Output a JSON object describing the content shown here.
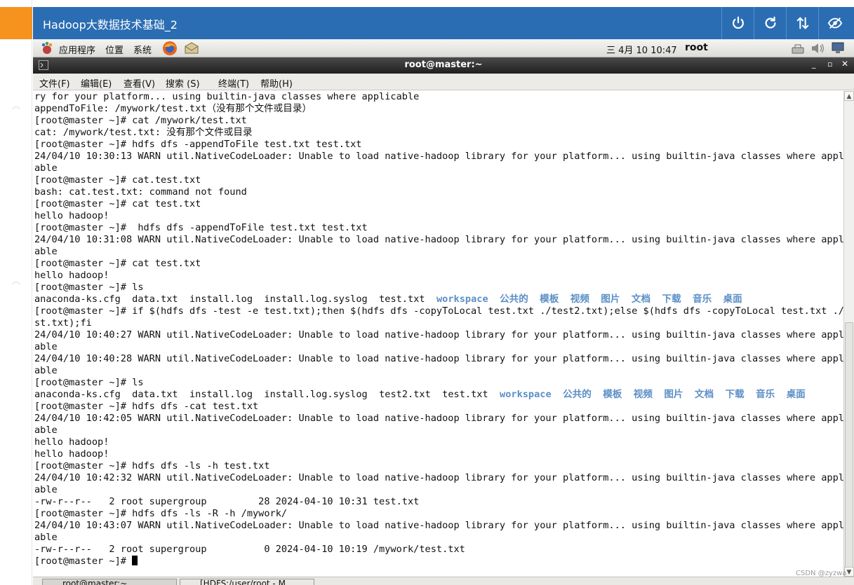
{
  "vm": {
    "title": "Hadoop大数据技术基础_2"
  },
  "panel": {
    "applications": "应用程序",
    "places": "位置",
    "system": "系统",
    "datetime": "三 4月 10 10:47",
    "user": "root"
  },
  "terminal": {
    "title": "root@master:~",
    "menu": [
      "文件(F)",
      "编辑(E)",
      "查看(V)",
      "搜索 (S)",
      "终端(T)",
      "帮助(H)"
    ],
    "lines": [
      "ry for your platform... using builtin-java classes where applicable",
      "appendToFile: /mywork/test.txt（没有那个文件或目录）",
      "[root@master ~]# cat /mywork/test.txt",
      "cat: /mywork/test.txt: 没有那个文件或目录",
      "[root@master ~]# hdfs dfs -appendToFile test.txt test.txt",
      "24/04/10 10:30:13 WARN util.NativeCodeLoader: Unable to load native-hadoop library for your platform... using builtin-java classes where applic",
      "able",
      "[root@master ~]# cat.test.txt",
      "bash: cat.test.txt: command not found",
      "[root@master ~]# cat test.txt",
      "hello hadoop!",
      "[root@master ~]#  hdfs dfs -appendToFile test.txt test.txt",
      "24/04/10 10:31:08 WARN util.NativeCodeLoader: Unable to load native-hadoop library for your platform... using builtin-java classes where applic",
      "able",
      "[root@master ~]# cat test.txt",
      "hello hadoop!",
      "[root@master ~]# ls",
      "__LS1__",
      "[root@master ~]# if $(hdfs dfs -test -e test.txt);then $(hdfs dfs -copyToLocal test.txt ./test2.txt);else $(hdfs dfs -copyToLocal test.txt ./te",
      "st.txt);fi",
      "24/04/10 10:40:27 WARN util.NativeCodeLoader: Unable to load native-hadoop library for your platform... using builtin-java classes where applic",
      "able",
      "24/04/10 10:40:28 WARN util.NativeCodeLoader: Unable to load native-hadoop library for your platform... using builtin-java classes where applic",
      "able",
      "[root@master ~]# ls",
      "__LS2__",
      "[root@master ~]# hdfs dfs -cat test.txt",
      "24/04/10 10:42:05 WARN util.NativeCodeLoader: Unable to load native-hadoop library for your platform... using builtin-java classes where applic",
      "able",
      "hello hadoop!",
      "hello hadoop!",
      "[root@master ~]# hdfs dfs -ls -h test.txt",
      "24/04/10 10:42:32 WARN util.NativeCodeLoader: Unable to load native-hadoop library for your platform... using builtin-java classes where applic",
      "able",
      "-rw-r--r--   2 root supergroup         28 2024-04-10 10:31 test.txt",
      "[root@master ~]# hdfs dfs -ls -R -h /mywork/",
      "24/04/10 10:43:07 WARN util.NativeCodeLoader: Unable to load native-hadoop library for your platform... using builtin-java classes where applic",
      "able",
      "-rw-r--r--   2 root supergroup          0 2024-04-10 10:19 /mywork/test.txt"
    ],
    "ls1_files": [
      "anaconda-ks.cfg",
      "data.txt",
      "install.log",
      "install.log.syslog",
      "test.txt"
    ],
    "ls1_dirs": [
      "workspace",
      "公共的",
      "模板",
      "视频",
      "图片",
      "文档",
      "下载",
      "音乐",
      "桌面"
    ],
    "ls2_files": [
      "anaconda-ks.cfg",
      "data.txt",
      "install.log",
      "install.log.syslog",
      "test2.txt",
      "test.txt"
    ],
    "ls2_dirs": [
      "workspace",
      "公共的",
      "模板",
      "视频",
      "图片",
      "文档",
      "下载",
      "音乐",
      "桌面"
    ],
    "prompt": "[root@master ~]# ",
    "dir_color": "#5c8fc6"
  },
  "taskbar": {
    "items": [
      "root@master:~",
      "[HDFS:/user/root - M"
    ]
  },
  "watermark": "CSDN @zyzwa",
  "colors": {
    "header_blue": "#2a6db3",
    "accent_orange": "#f6921e"
  },
  "icons": [
    "power-icon",
    "refresh-icon",
    "transfer-icon",
    "eye-icon",
    "gnome-foot-icon",
    "firefox-icon",
    "network-icon",
    "volume-icon",
    "display-icon"
  ]
}
